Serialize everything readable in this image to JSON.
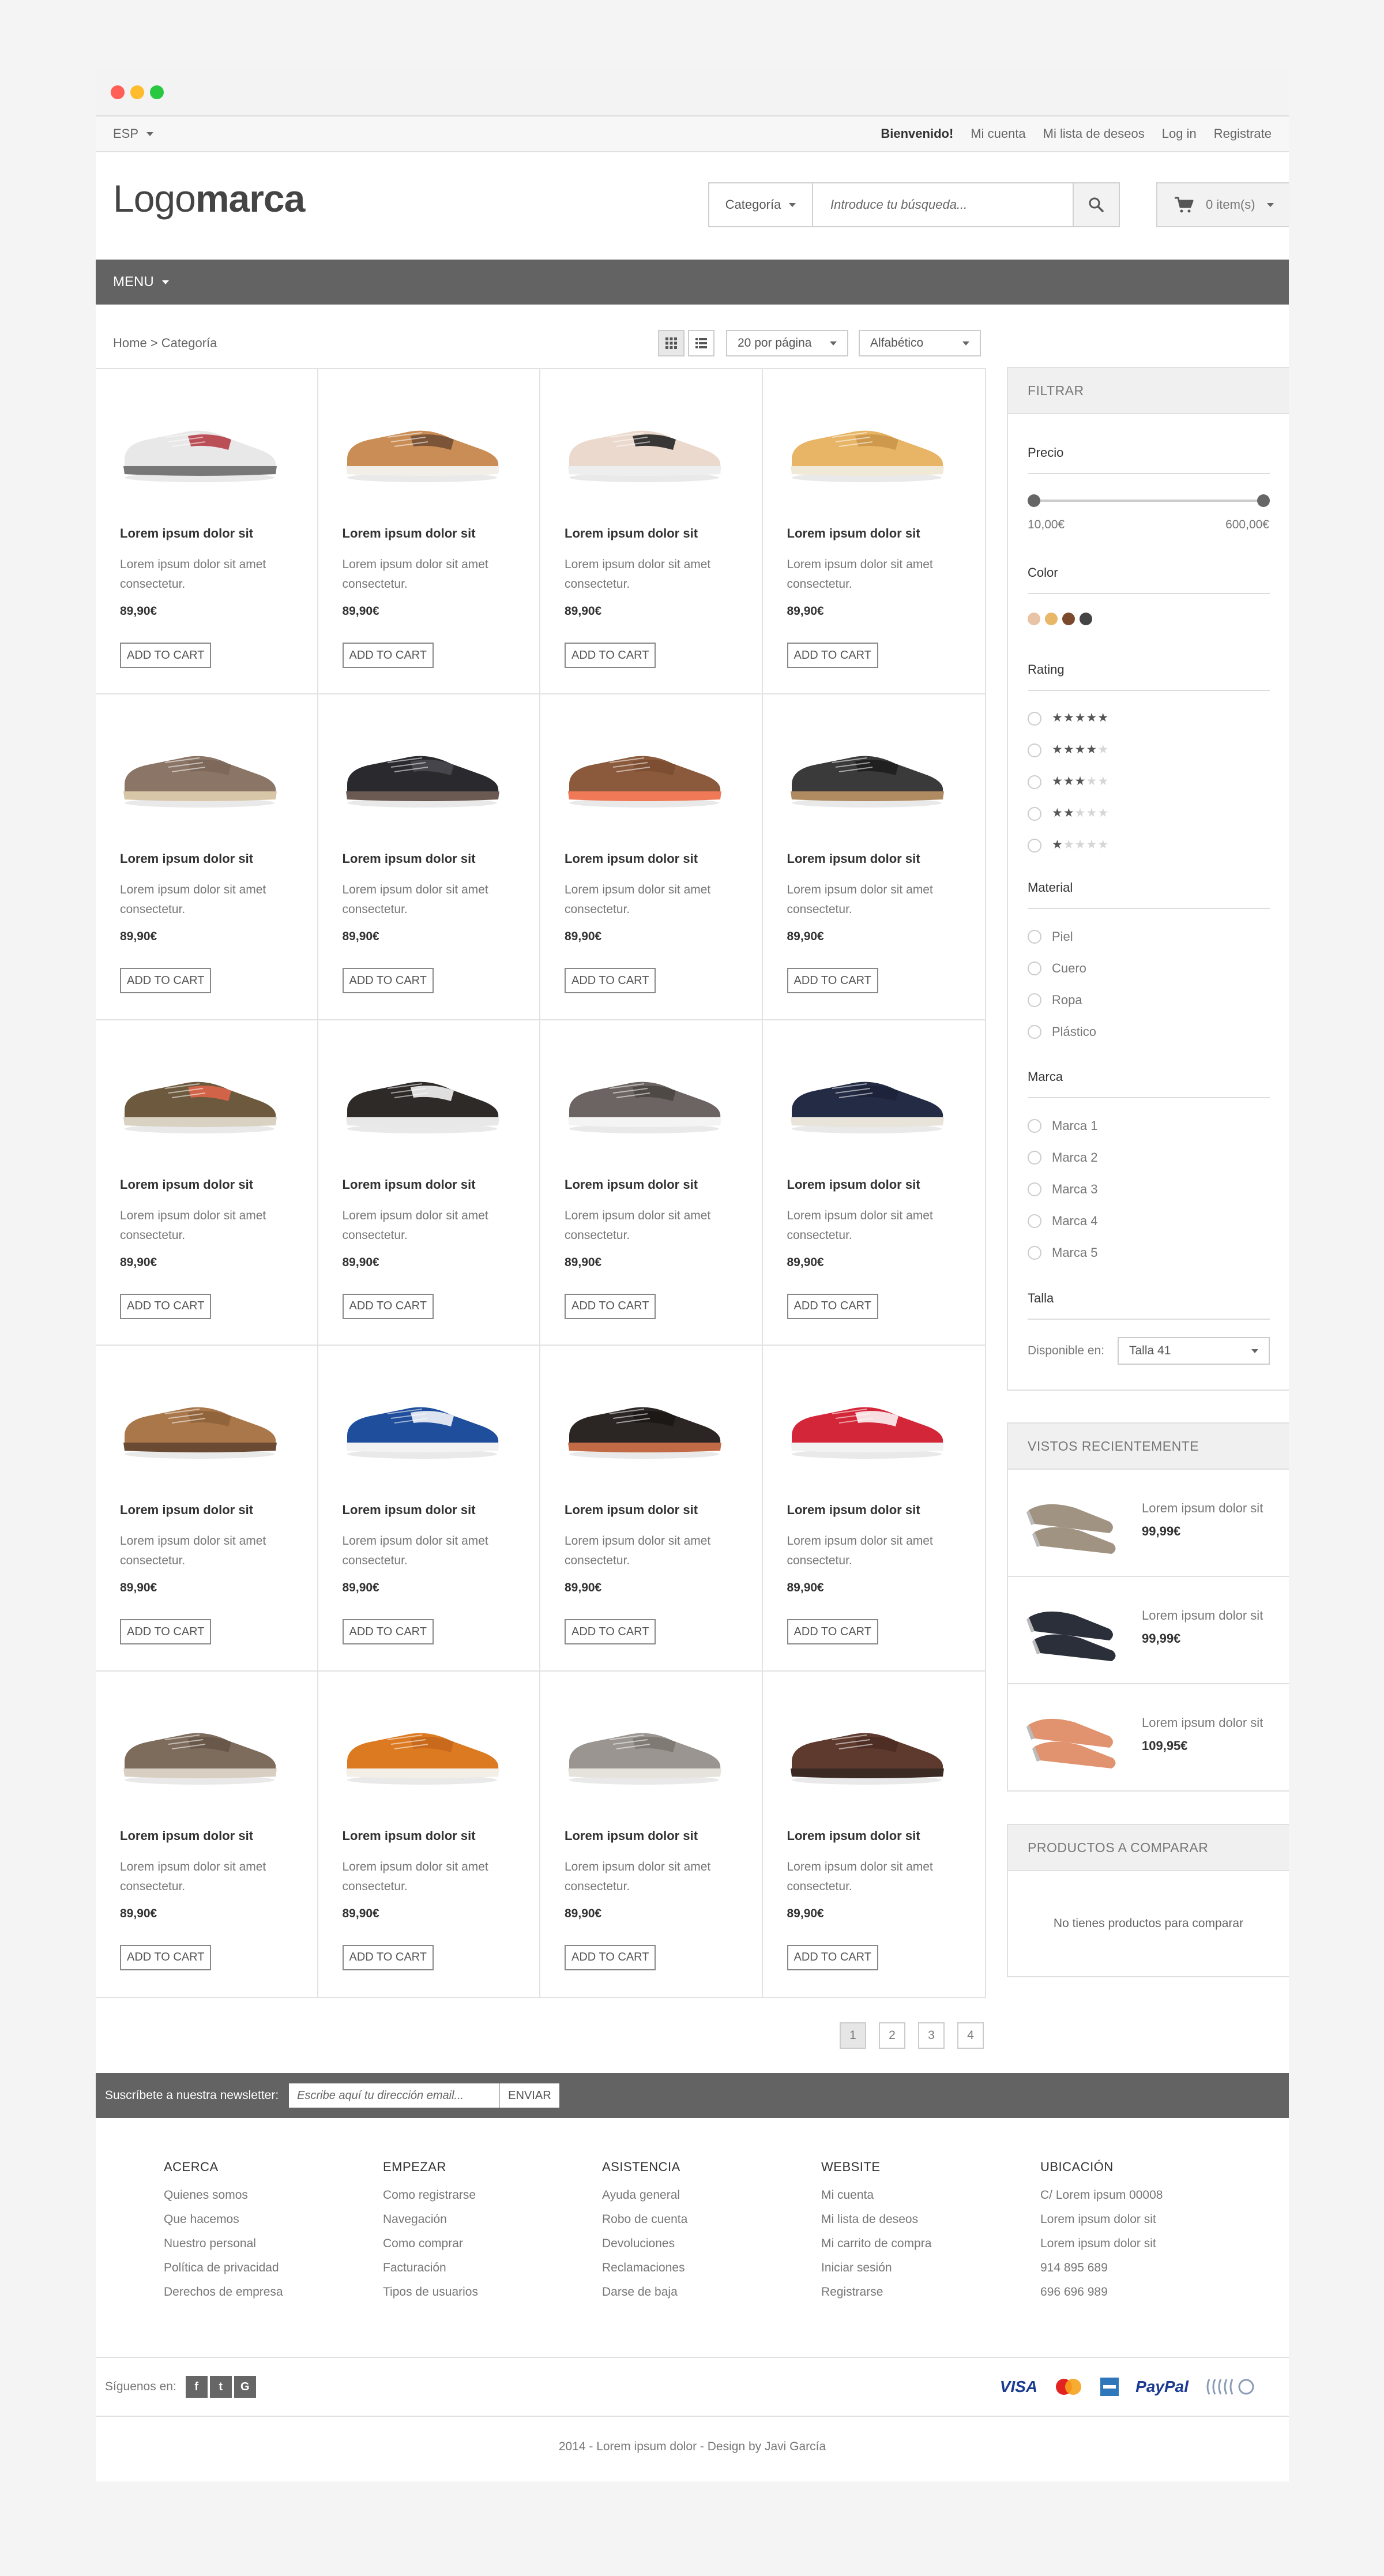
{
  "topbar": {
    "language": "ESP",
    "links": [
      "Bienvenido!",
      "Mi cuenta",
      "Mi lista de deseos",
      "Log in",
      "Registrate"
    ]
  },
  "header": {
    "logo_light": "Logo",
    "logo_bold": "marca",
    "search_category": "Categoría",
    "search_placeholder": "Introduce tu búsqueda...",
    "cart_label": "0 item(s)"
  },
  "menu": {
    "label": "MENU"
  },
  "toolbar": {
    "breadcrumb": "Home > Categoría",
    "per_page": "20 por página",
    "sort": "Alfabético"
  },
  "product_common": {
    "name": "Lorem ipsum dolor sit",
    "desc": "Lorem ipsum dolor sit amet consectetur.",
    "price": "89,90€",
    "add_to_cart": "ADD TO CART"
  },
  "products": [
    {
      "upper": "#e8e8e8",
      "accent": "#b3343e",
      "sole": "#777777"
    },
    {
      "upper": "#c98d55",
      "accent": "#6e4a32",
      "sole": "#f2efe8"
    },
    {
      "upper": "#ead9cc",
      "accent": "#1a1a1a",
      "sole": "#eeeeee"
    },
    {
      "upper": "#e8b465",
      "accent": "#c99448",
      "sole": "#f0e9d8"
    },
    {
      "upper": "#8a7566",
      "accent": "#7a6658",
      "sole": "#d8c6a8"
    },
    {
      "upper": "#2a2a2e",
      "accent": "#4a4a50",
      "sole": "#6a5a52"
    },
    {
      "upper": "#8b5a3c",
      "accent": "#7a4c30",
      "sole": "#f07a58"
    },
    {
      "upper": "#3a3a3a",
      "accent": "#1c1c1c",
      "sole": "#b08a60"
    },
    {
      "upper": "#6d5a3e",
      "accent": "#e3664a",
      "sole": "#d9d2c2"
    },
    {
      "upper": "#2e2a28",
      "accent": "#ffffff",
      "sole": "#e8e8e8"
    },
    {
      "upper": "#6b6462",
      "accent": "#4a4442",
      "sole": "#f4f4f4"
    },
    {
      "upper": "#232b45",
      "accent": "#1b2238",
      "sole": "#e9e4da"
    },
    {
      "upper": "#a9774a",
      "accent": "#8d6038",
      "sole": "#6a4a32"
    },
    {
      "upper": "#1f4e9c",
      "accent": "#ffffff",
      "sole": "#f2f2f2"
    },
    {
      "upper": "#2b2624",
      "accent": "#1a1614",
      "sole": "#c26a45"
    },
    {
      "upper": "#d32638",
      "accent": "#ffffff",
      "sole": "#f2f2f2"
    },
    {
      "upper": "#7d6b5c",
      "accent": "#655546",
      "sole": "#d8cfc2"
    },
    {
      "upper": "#dc7a22",
      "accent": "#c4661a",
      "sole": "#f4efe6"
    },
    {
      "upper": "#9a9590",
      "accent": "#7a7570",
      "sole": "#e6e2dc"
    },
    {
      "upper": "#5e3a2e",
      "accent": "#4a2c22",
      "sole": "#3a2a22"
    }
  ],
  "pagination": [
    "1",
    "2",
    "3",
    "4"
  ],
  "filter": {
    "title": "FILTRAR",
    "price_title": "Precio",
    "price_min": "10,00€",
    "price_max": "600,00€",
    "color_title": "Color",
    "colors": [
      "#e9c3a6",
      "#e8b868",
      "#7b4a2c",
      "#444444"
    ],
    "rating_title": "Rating",
    "ratings": [
      5,
      4,
      3,
      2,
      1
    ],
    "material_title": "Material",
    "materials": [
      "Piel",
      "Cuero",
      "Ropa",
      "Plástico"
    ],
    "brand_title": "Marca",
    "brands": [
      "Marca 1",
      "Marca 2",
      "Marca 3",
      "Marca 4",
      "Marca 5"
    ],
    "size_title": "Talla",
    "size_label": "Disponible en:",
    "size_value": "Talla 41"
  },
  "recent": {
    "title": "VISTOS RECIENTEMENTE",
    "items": [
      {
        "name": "Lorem ipsum dolor sit",
        "price": "99,99€",
        "color": "#a09382"
      },
      {
        "name": "Lorem ipsum dolor sit",
        "price": "99,99€",
        "color": "#2b2f3a"
      },
      {
        "name": "Lorem ipsum dolor sit",
        "price": "109,95€",
        "color": "#e0936e"
      }
    ]
  },
  "compare": {
    "title": "PRODUCTOS A COMPARAR",
    "empty": "No tienes productos para comparar"
  },
  "newsletter": {
    "label": "Suscríbete a nuestra newsletter:",
    "placeholder": "Escribe aquí tu dirección email...",
    "button": "ENVIAR"
  },
  "footer": {
    "columns": [
      {
        "title": "ACERCA",
        "links": [
          "Quienes somos",
          "Que hacemos",
          "Nuestro personal",
          "Política de privacidad",
          "Derechos de empresa"
        ]
      },
      {
        "title": "EMPEZAR",
        "links": [
          "Como registrarse",
          "Navegación",
          "Como comprar",
          "Facturación",
          "Tipos de usuarios"
        ]
      },
      {
        "title": "ASISTENCIA",
        "links": [
          "Ayuda general",
          "Robo de cuenta",
          "Devoluciones",
          "Reclamaciones",
          "Darse de baja"
        ]
      },
      {
        "title": "WEBSITE",
        "links": [
          "Mi cuenta",
          "Mi lista de deseos",
          "Mi carrito de compra",
          "Iniciar sesión",
          "Registrarse"
        ]
      },
      {
        "title": "UBICACIÓN",
        "links": [
          "C/ Lorem ipsum 00008",
          "Lorem ipsum dolor sit",
          "Lorem ipsum dolor sit",
          "914 895 689",
          "696 696 989"
        ]
      }
    ],
    "social_label": "Síguenos en:",
    "social": [
      "f",
      "t",
      "G"
    ],
    "payments": [
      "VISA",
      "PayPal"
    ],
    "copyright": "2014 - Lorem ipsum dolor - Design by Javi García"
  }
}
